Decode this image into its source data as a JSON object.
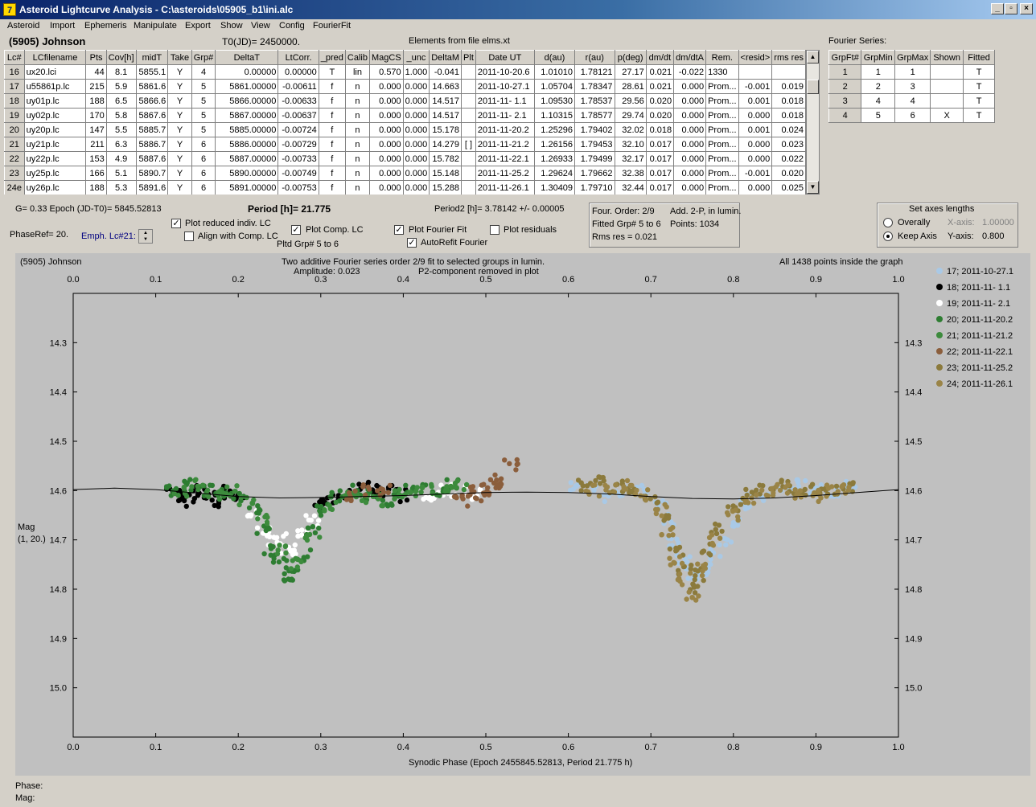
{
  "window": {
    "title": "Asteroid Lightcurve Analysis - C:\\asteroids\\05905_b1\\ini.alc",
    "icon_glyph": "7",
    "minimize": "_",
    "restore": "▫",
    "close": "×"
  },
  "menu": [
    "Asteroid",
    "Import",
    "Ephemeris",
    "Manipulate",
    "Export",
    "Show",
    "View",
    "Config",
    "FourierFit"
  ],
  "header": {
    "asteroid": "(5905) Johnson",
    "t0": "T0(JD)= 2450000.",
    "elements": "Elements from file elms.xt"
  },
  "lc_table": {
    "columns": [
      "Lc#",
      "LCfilename",
      "Pts",
      "Cov[h]",
      "midT",
      "Take",
      "Grp#",
      "DeltaT",
      "LtCorr.",
      "_pred",
      "Calib",
      "MagCS",
      "_unc",
      "DeltaM",
      "Plt",
      "Date UT",
      "d(au)",
      "r(au)",
      "p(deg)",
      "dm/dt",
      "dm/dtA",
      "Rem.",
      "<resid>",
      "rms res"
    ],
    "rows": [
      [
        "16",
        "ux20.lci",
        "44",
        "8.1",
        "5855.1",
        "Y",
        "4",
        "0.00000",
        "0.00000",
        "T",
        "lin",
        "0.570",
        "1.000",
        "-0.041",
        "",
        "2011-10-20.6",
        "1.01010",
        "1.78121",
        "27.17",
        "0.021",
        "-0.022",
        "1330",
        "",
        ""
      ],
      [
        "17",
        "u55861p.lc",
        "215",
        "5.9",
        "5861.6",
        "Y",
        "5",
        "5861.00000",
        "-0.00611",
        "f",
        "n",
        "0.000",
        "0.000",
        "14.663",
        "",
        "2011-10-27.1",
        "1.05704",
        "1.78347",
        "28.61",
        "0.021",
        "0.000",
        "Prom...",
        "-0.001",
        "0.019"
      ],
      [
        "18",
        "uy01p.lc",
        "188",
        "6.5",
        "5866.6",
        "Y",
        "5",
        "5866.00000",
        "-0.00633",
        "f",
        "n",
        "0.000",
        "0.000",
        "14.517",
        "",
        "2011-11- 1.1",
        "1.09530",
        "1.78537",
        "29.56",
        "0.020",
        "0.000",
        "Prom...",
        "0.001",
        "0.018"
      ],
      [
        "19",
        "uy02p.lc",
        "170",
        "5.8",
        "5867.6",
        "Y",
        "5",
        "5867.00000",
        "-0.00637",
        "f",
        "n",
        "0.000",
        "0.000",
        "14.517",
        "",
        "2011-11- 2.1",
        "1.10315",
        "1.78577",
        "29.74",
        "0.020",
        "0.000",
        "Prom...",
        "0.000",
        "0.018"
      ],
      [
        "20",
        "uy20p.lc",
        "147",
        "5.5",
        "5885.7",
        "Y",
        "5",
        "5885.00000",
        "-0.00724",
        "f",
        "n",
        "0.000",
        "0.000",
        "15.178",
        "",
        "2011-11-20.2",
        "1.25296",
        "1.79402",
        "32.02",
        "0.018",
        "0.000",
        "Prom...",
        "0.001",
        "0.024"
      ],
      [
        "21",
        "uy21p.lc",
        "211",
        "6.3",
        "5886.7",
        "Y",
        "6",
        "5886.00000",
        "-0.00729",
        "f",
        "n",
        "0.000",
        "0.000",
        "14.279",
        "[ ]",
        "2011-11-21.2",
        "1.26156",
        "1.79453",
        "32.10",
        "0.017",
        "0.000",
        "Prom...",
        "0.000",
        "0.023"
      ],
      [
        "22",
        "uy22p.lc",
        "153",
        "4.9",
        "5887.6",
        "Y",
        "6",
        "5887.00000",
        "-0.00733",
        "f",
        "n",
        "0.000",
        "0.000",
        "15.782",
        "",
        "2011-11-22.1",
        "1.26933",
        "1.79499",
        "32.17",
        "0.017",
        "0.000",
        "Prom...",
        "0.000",
        "0.022"
      ],
      [
        "23",
        "uy25p.lc",
        "166",
        "5.1",
        "5890.7",
        "Y",
        "6",
        "5890.00000",
        "-0.00749",
        "f",
        "n",
        "0.000",
        "0.000",
        "15.148",
        "",
        "2011-11-25.2",
        "1.29624",
        "1.79662",
        "32.38",
        "0.017",
        "0.000",
        "Prom...",
        "-0.001",
        "0.020"
      ],
      [
        "24e",
        "uy26p.lc",
        "188",
        "5.3",
        "5891.6",
        "Y",
        "6",
        "5891.00000",
        "-0.00753",
        "f",
        "n",
        "0.000",
        "0.000",
        "15.288",
        "",
        "2011-11-26.1",
        "1.30409",
        "1.79710",
        "32.44",
        "0.017",
        "0.000",
        "Prom...",
        "0.000",
        "0.025"
      ]
    ]
  },
  "fourier_table": {
    "title": "Fourier Series:",
    "columns": [
      "GrpFt#",
      "GrpMin",
      "GrpMax",
      "Shown",
      "Fitted"
    ],
    "rows": [
      [
        "1",
        "1",
        "1",
        "",
        "T"
      ],
      [
        "2",
        "2",
        "3",
        "",
        "T"
      ],
      [
        "3",
        "4",
        "4",
        "",
        "T"
      ],
      [
        "4",
        "5",
        "6",
        "X",
        "T"
      ]
    ]
  },
  "controls": {
    "g_epoch": "G= 0.33   Epoch (JD-T0)= 5845.52813",
    "period": "Period [h]= 21.775",
    "period2": "Period2 [h]= 3.78142 +/- 0.00005",
    "phase_ref": "PhaseRef= 20.",
    "emph_lc": "Emph. Lc#21:",
    "plot_reduced": "Plot reduced indiv. LC",
    "align_comp": "Align with Comp. LC",
    "plot_comp": "Plot Comp. LC",
    "pltd_grp": "Pltd Grp#  5  to  6",
    "plot_fourier": "Plot Fourier Fit",
    "autorefit": "AutoRefit Fourier",
    "plot_residuals": "Plot residuals",
    "four_order": "Four. Order:  2/9",
    "add_2p": "Add. 2-P, in lumin.",
    "fitted_grp": "Fitted Grp# 5 to 6",
    "points": "Points: 1034",
    "rms_res": "Rms res     = 0.021",
    "axes_title": "Set axes lengths",
    "overally": "Overally",
    "keep_axis": "Keep Axis",
    "x_axis_label": "X-axis:",
    "x_axis_val": "1.00000",
    "y_axis_label": "Y-axis:",
    "y_axis_val": "0.800"
  },
  "plot": {
    "corner_label": "(5905) Johnson",
    "title_line1": "Two additive Fourier series order 2/9 fit to selected groups in lumin.",
    "title_line2_left": "Amplitude: 0.023",
    "title_line2_right": "P2-component removed in plot",
    "points_inside": "All 1438 points inside the graph",
    "x_title": "Synodic Phase (Epoch 2455845.52813, Period 21.775 h)",
    "y_title_1": "Mag",
    "y_title_2": "(1, 20.)",
    "status_phase": "Phase:",
    "status_mag": "Mag:",
    "bg_color": "#c0c0c0",
    "legend": [
      {
        "label": "17; 2011-10-27.1",
        "color": "#a9c9e6"
      },
      {
        "label": "18; 2011-11- 1.1",
        "color": "#000000"
      },
      {
        "label": "19; 2011-11- 2.1",
        "color": "#ffffff"
      },
      {
        "label": "20; 2011-11-20.2",
        "color": "#2e7d32"
      },
      {
        "label": "21; 2011-11-21.2",
        "color": "#3d8b3d"
      },
      {
        "label": "22; 2011-11-22.1",
        "color": "#8b5e3c"
      },
      {
        "label": "23; 2011-11-25.2",
        "color": "#8b7a3c"
      },
      {
        "label": "24; 2011-11-26.1",
        "color": "#9a8447"
      }
    ]
  },
  "chart_data": {
    "type": "scatter",
    "xlabel": "Synodic Phase (Epoch 2455845.52813, Period 21.775 h)",
    "ylabel": "Mag",
    "xlim": [
      0.0,
      1.0
    ],
    "ylim": [
      14.2,
      15.1
    ],
    "y_inverted": true,
    "x_ticks": [
      "0.0",
      "0.1",
      "0.2",
      "0.3",
      "0.4",
      "0.5",
      "0.6",
      "0.7",
      "0.8",
      "0.9",
      "1.0"
    ],
    "y_ticks": [
      "14.3",
      "14.4",
      "14.5",
      "14.6",
      "14.7",
      "14.8",
      "14.9",
      "15.0"
    ],
    "fit_curve": {
      "x": [
        0.0,
        0.05,
        0.1,
        0.15,
        0.2,
        0.25,
        0.3,
        0.35,
        0.4,
        0.45,
        0.5,
        0.55,
        0.6,
        0.65,
        0.7,
        0.75,
        0.8,
        0.85,
        0.9,
        0.95,
        1.0
      ],
      "y": [
        14.598,
        14.595,
        14.598,
        14.605,
        14.612,
        14.615,
        14.614,
        14.612,
        14.61,
        14.607,
        14.604,
        14.603,
        14.604,
        14.607,
        14.612,
        14.616,
        14.617,
        14.615,
        14.61,
        14.604,
        14.598
      ]
    },
    "series": [
      {
        "name": "17; 2011-10-27.1",
        "x": [
          0.61,
          0.63,
          0.65,
          0.67,
          0.69,
          0.71,
          0.72,
          0.73,
          0.74,
          0.75,
          0.76,
          0.77,
          0.78,
          0.79,
          0.8,
          0.81,
          0.82,
          0.84,
          0.86,
          0.88,
          0.9,
          0.92,
          0.94
        ],
        "y": [
          14.59,
          14.6,
          14.61,
          14.6,
          14.6,
          14.63,
          14.66,
          14.7,
          14.74,
          14.77,
          14.78,
          14.76,
          14.73,
          14.7,
          14.66,
          14.63,
          14.62,
          14.61,
          14.6,
          14.59,
          14.6,
          14.6,
          14.59
        ]
      },
      {
        "name": "18; 2011-11- 1.1",
        "x": [
          0.12,
          0.13,
          0.14,
          0.15,
          0.16,
          0.17,
          0.18,
          0.19,
          0.2,
          0.3,
          0.31,
          0.33,
          0.35,
          0.37,
          0.38,
          0.4
        ],
        "y": [
          14.6,
          14.61,
          14.62,
          14.6,
          14.61,
          14.62,
          14.61,
          14.6,
          14.61,
          14.63,
          14.62,
          14.61,
          14.59,
          14.6,
          14.6,
          14.61
        ]
      },
      {
        "name": "19; 2011-11- 2.1",
        "x": [
          0.22,
          0.23,
          0.24,
          0.25,
          0.26,
          0.27,
          0.28,
          0.29,
          0.43,
          0.45,
          0.47,
          0.49
        ],
        "y": [
          14.65,
          14.68,
          14.7,
          14.7,
          14.72,
          14.73,
          14.69,
          14.66,
          14.61,
          14.6,
          14.6,
          14.61
        ]
      },
      {
        "name": "20; 2011-11-20.2",
        "x": [
          0.12,
          0.14,
          0.16,
          0.18,
          0.2,
          0.22,
          0.23,
          0.24,
          0.25,
          0.26,
          0.27,
          0.28,
          0.29,
          0.3,
          0.32,
          0.34,
          0.36,
          0.38,
          0.4,
          0.42,
          0.44,
          0.46
        ],
        "y": [
          14.6,
          14.59,
          14.6,
          14.6,
          14.61,
          14.64,
          14.68,
          14.72,
          14.75,
          14.78,
          14.77,
          14.73,
          14.68,
          14.64,
          14.61,
          14.6,
          14.61,
          14.62,
          14.6,
          14.6,
          14.6,
          14.59
        ]
      },
      {
        "name": "21; 2011-11-21.2",
        "x": [
          0.13,
          0.15,
          0.17,
          0.19,
          0.21,
          0.23,
          0.25,
          0.27,
          0.29,
          0.31,
          0.33,
          0.35,
          0.37,
          0.39,
          0.41,
          0.43,
          0.45,
          0.47
        ],
        "y": [
          14.6,
          14.59,
          14.61,
          14.6,
          14.62,
          14.66,
          14.72,
          14.75,
          14.7,
          14.63,
          14.61,
          14.62,
          14.62,
          14.61,
          14.6,
          14.6,
          14.59,
          14.59
        ]
      },
      {
        "name": "22; 2011-11-22.1",
        "x": [
          0.34,
          0.36,
          0.38,
          0.47,
          0.48,
          0.49,
          0.5,
          0.51,
          0.52,
          0.53
        ],
        "y": [
          14.61,
          14.6,
          14.6,
          14.62,
          14.61,
          14.6,
          14.61,
          14.59,
          14.58,
          14.55
        ]
      },
      {
        "name": "23; 2011-11-25.2",
        "x": [
          0.62,
          0.64,
          0.66,
          0.68,
          0.7,
          0.72,
          0.73,
          0.74,
          0.75,
          0.76,
          0.77,
          0.78,
          0.8,
          0.82,
          0.84,
          0.86,
          0.88,
          0.9,
          0.92,
          0.94
        ],
        "y": [
          14.59,
          14.58,
          14.59,
          14.6,
          14.62,
          14.66,
          14.72,
          14.76,
          14.8,
          14.77,
          14.72,
          14.68,
          14.64,
          14.61,
          14.6,
          14.59,
          14.6,
          14.6,
          14.6,
          14.59
        ]
      },
      {
        "name": "24; 2011-11-26.1",
        "x": [
          0.63,
          0.65,
          0.67,
          0.69,
          0.71,
          0.72,
          0.73,
          0.74,
          0.75,
          0.76,
          0.78,
          0.8,
          0.82,
          0.84,
          0.86,
          0.88,
          0.9,
          0.92,
          0.94
        ],
        "y": [
          14.6,
          14.6,
          14.59,
          14.61,
          14.64,
          14.68,
          14.74,
          14.78,
          14.81,
          14.76,
          14.7,
          14.65,
          14.62,
          14.6,
          14.6,
          14.61,
          14.61,
          14.6,
          14.6
        ]
      }
    ]
  }
}
